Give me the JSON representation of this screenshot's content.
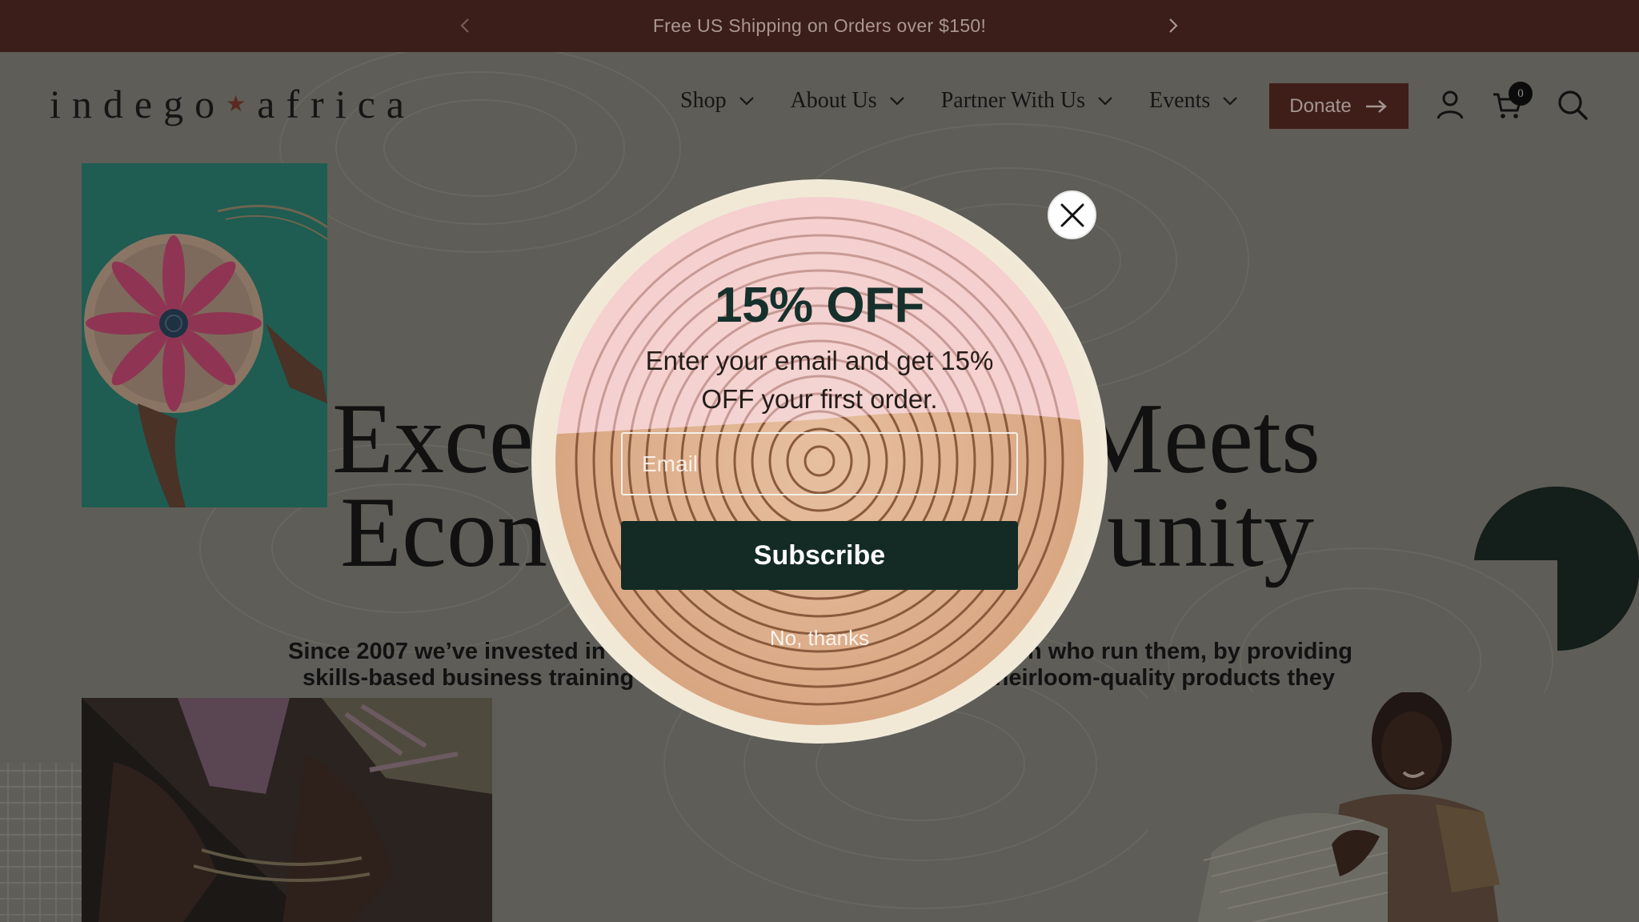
{
  "announcement": {
    "text": "Free US Shipping on Orders over $150!",
    "prev_icon": "chevron-left-icon",
    "next_icon": "chevron-right-icon"
  },
  "header": {
    "logo_left": "indego",
    "logo_right": "africa",
    "nav": [
      {
        "label": "Shop"
      },
      {
        "label": "About Us"
      },
      {
        "label": "Partner With Us"
      },
      {
        "label": "Events"
      }
    ],
    "donate_label": "Donate",
    "cart_count": "0",
    "icons": [
      "account-icon",
      "cart-icon",
      "search-icon"
    ]
  },
  "hero": {
    "title_line1_left": "Exce",
    "title_line1_right": "Meets",
    "title_line2_left": "Econ",
    "title_line2_right": "unity",
    "sub_line1_left": "Since 2007 we’ve invested in",
    "sub_line1_right": "en who run them, by providing",
    "sub_line2_left": "skills-based business training a",
    "sub_line2_right": "heirloom-quality products they"
  },
  "modal": {
    "heading": "15% OFF",
    "text": "Enter your email and get 15% OFF your first order.",
    "email_placeholder": "Email",
    "subscribe_label": "Subscribe",
    "dismiss_label": "No, thanks",
    "close_icon": "close-icon"
  },
  "colors": {
    "announcement_bg": "#3b1d1a",
    "donate_bg": "#3f1e1a",
    "subscribe_bg": "#132a25",
    "heading_color": "#16302b"
  }
}
